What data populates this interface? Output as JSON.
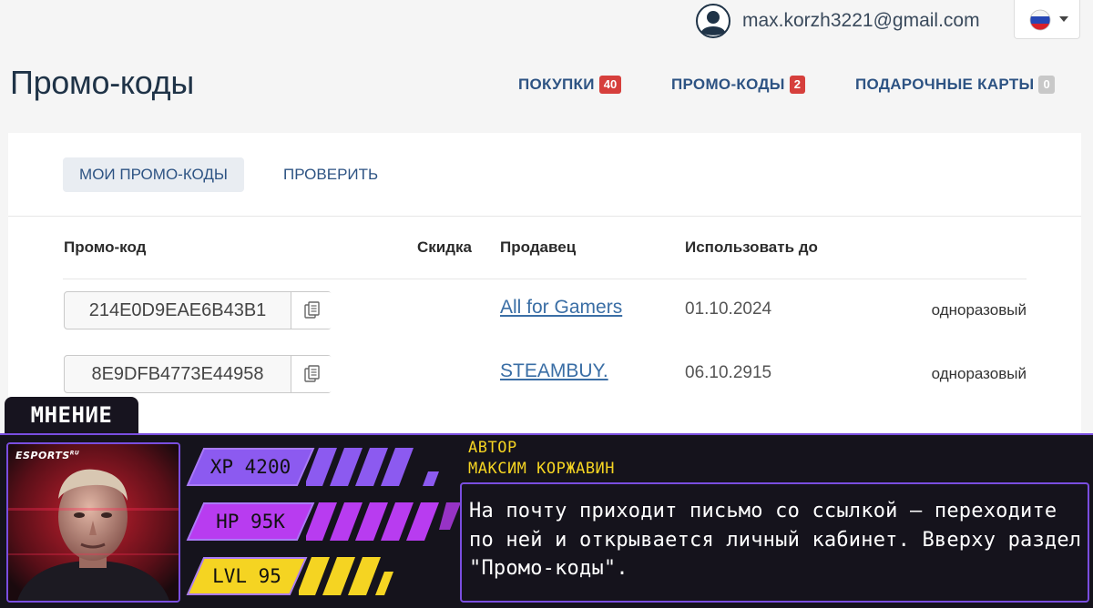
{
  "header": {
    "user_email": "max.korzh3221@gmail.com",
    "avatar_icon": "user-avatar-icon",
    "language_flag": "flag-ru-icon"
  },
  "page": {
    "title": "Промо-коды"
  },
  "topnav": [
    {
      "label": "ПОКУПКИ",
      "count": "40",
      "badge_color": "#d63f3c"
    },
    {
      "label": "ПРОМО-КОДЫ",
      "count": "2",
      "badge_color": "#d63f3c"
    },
    {
      "label": "ПОДАРОЧНЫЕ КАРТЫ",
      "count": "0",
      "badge_color": "#c8c8c8"
    }
  ],
  "tabs": {
    "my_codes": "МОИ ПРОМО-КОДЫ",
    "check": "ПРОВЕРИТЬ"
  },
  "table": {
    "headers": {
      "code": "Промо-код",
      "discount": "Скидка",
      "seller": "Продавец",
      "valid_until": "Использовать до"
    },
    "rows": [
      {
        "code": "214E0D9EAE6B43B1",
        "discount": "",
        "seller": "All for Gamers",
        "valid_until": "01.10.2024",
        "type": "одноразовый"
      },
      {
        "code": "8E9DFB4773E44958",
        "discount": "",
        "seller": "STEAMBUY.",
        "valid_until": "06.10.2915",
        "type": "одноразовый"
      }
    ]
  },
  "opinion": {
    "tab_label": "МНЕНИЕ",
    "brand": "ESPORTS",
    "brand_suffix": "RU",
    "stats": [
      {
        "label": "XP 4200",
        "color": "#8c5af0"
      },
      {
        "label": "HP 95K",
        "color": "#b83cf0"
      },
      {
        "label": "LVL 95",
        "color": "#f5d422"
      }
    ],
    "author_label": "АВТОР",
    "author_name": "МАКСИМ КОРЖАВИН",
    "quote": "На почту приходит письмо со ссылкой — переходите по ней и открывается личный кабинет. Вверху раздел \"Промо-коды\"."
  },
  "colors": {
    "accent": "#2d5383",
    "banner_purple": "#7a4ee0",
    "banner_yellow": "#f5d422"
  }
}
